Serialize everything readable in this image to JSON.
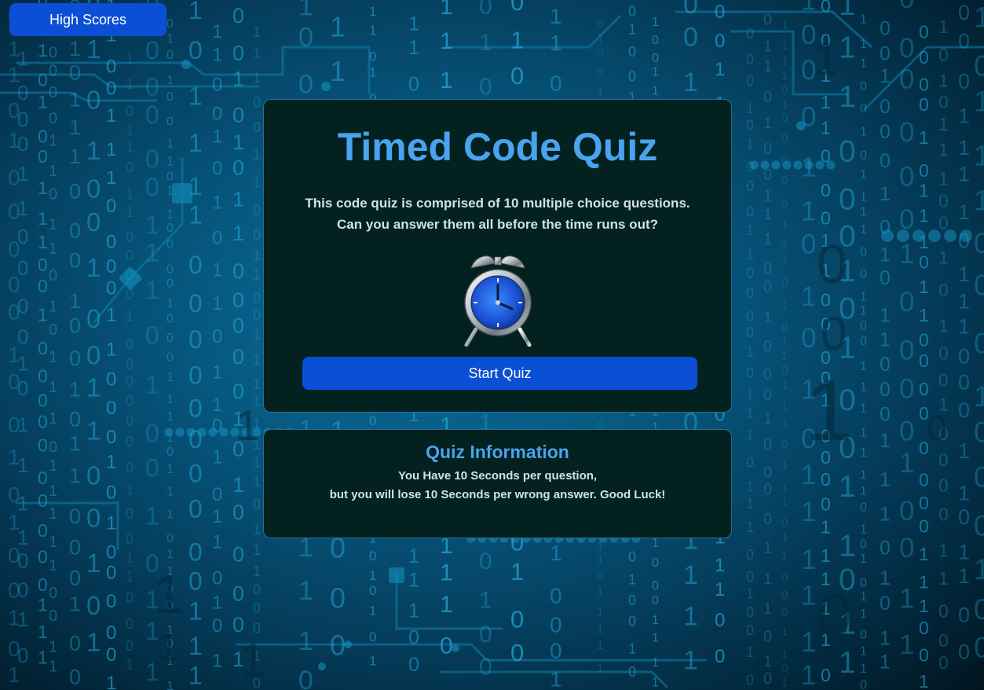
{
  "header": {
    "high_scores_label": "High Scores"
  },
  "main": {
    "title": "Timed Code Quiz",
    "description_line1": "This code quiz is comprised of 10 multiple choice questions.",
    "description_line2": "Can you answer them all before the time runs out?",
    "image_icon": "alarm-clock-icon",
    "start_label": "Start Quiz"
  },
  "info": {
    "title": "Quiz Information",
    "line1": "You Have 10 Seconds per question,",
    "line2": "but you will lose 10 Seconds per wrong answer. Good Luck!"
  },
  "background": {
    "digits": [
      "0",
      "1"
    ]
  },
  "colors": {
    "accent": "#4aa3ee",
    "button": "#0b4fd6",
    "card_bg": "#02211f",
    "text": "#cfe0ee"
  }
}
